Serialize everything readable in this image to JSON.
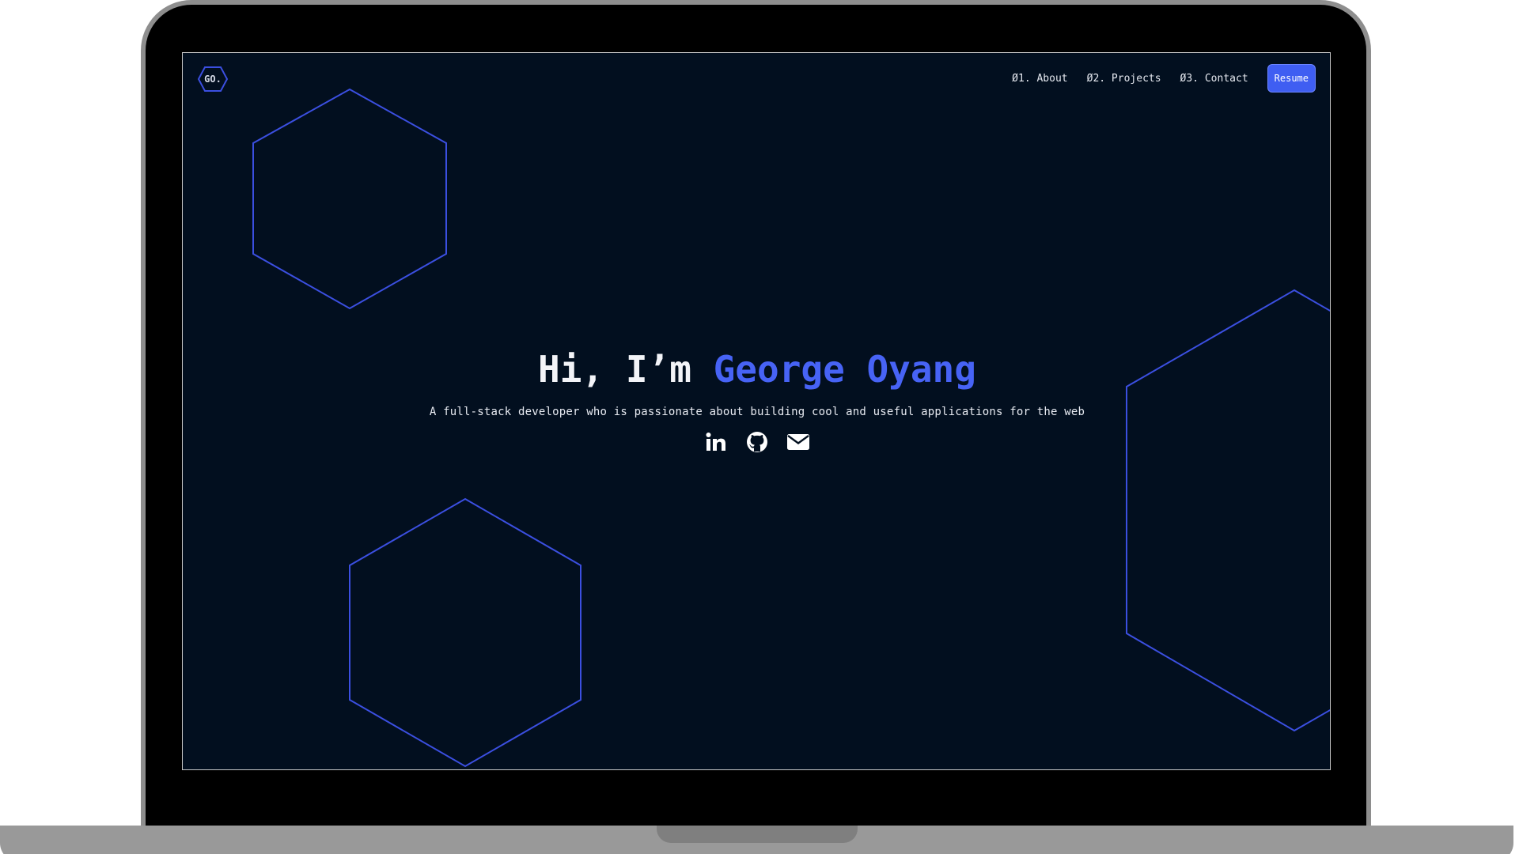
{
  "colors": {
    "background": "#020f1f",
    "accent": "#4763f5",
    "text": "#f3f4f8"
  },
  "header": {
    "logo_text": "GO.",
    "nav": [
      {
        "label": "Ø1. About"
      },
      {
        "label": "Ø2. Projects"
      },
      {
        "label": "Ø3. Contact"
      }
    ],
    "resume_label": "Resume"
  },
  "hero": {
    "greeting": "Hi, I’m ",
    "name": "George Oyang",
    "tagline": "A full-stack developer who is passionate about building cool and useful applications for the web"
  },
  "socials": [
    {
      "icon": "linkedin-icon"
    },
    {
      "icon": "github-icon"
    },
    {
      "icon": "email-icon"
    }
  ]
}
